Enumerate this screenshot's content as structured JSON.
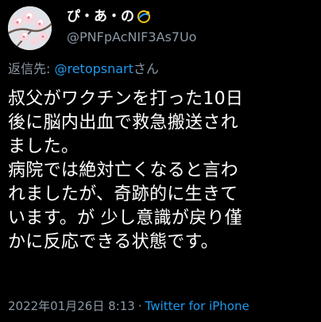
{
  "author": {
    "display_name": "ぴ・あ・の",
    "handle": "@PNFpAcNIF3As7Uo",
    "avatar_icon": "cherry-blossom-avatar",
    "name_emoji_icon": "dizzy-emoji-icon"
  },
  "reply": {
    "prefix": "返信先: ",
    "target_handle": "@retopsnart",
    "suffix": "さん"
  },
  "tweet": {
    "text": "叔父がワクチンを打った10日\n後に脳内出血で救急搬送され\nました。\n病院では絶対亡くなると言わ\nれましたが、奇跡的に生きて\nいます。が 少し意識が戻り僅\nかに反応できる状態です。"
  },
  "meta": {
    "date": "2022年01月26日",
    "time": "8:13",
    "separator": "·",
    "source": "Twitter for iPhone"
  },
  "colors": {
    "background": "#000000",
    "text": "#ffffff",
    "secondary": "#8b98a5",
    "link": "#1d9bf0"
  }
}
